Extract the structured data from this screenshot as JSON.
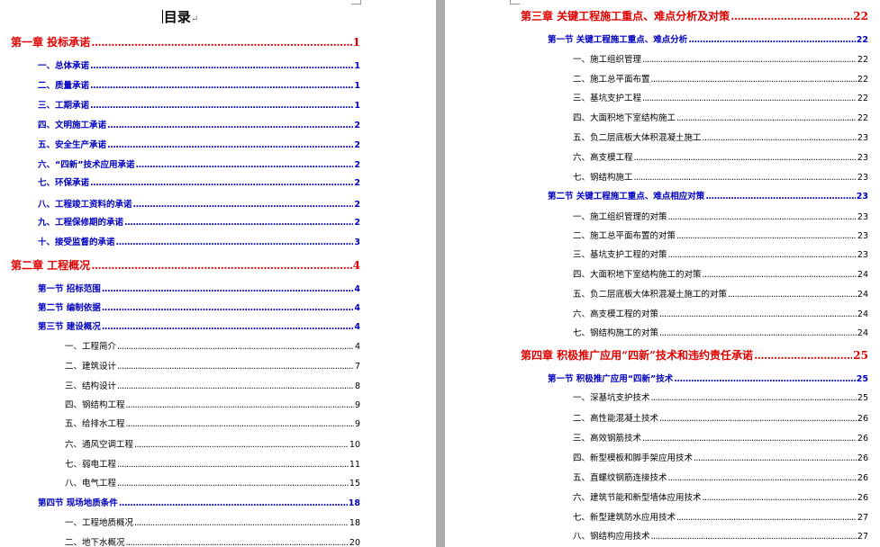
{
  "document": {
    "title": "目录",
    "paragraph_mark": "↵",
    "left_page": [
      {
        "level": 1,
        "text": "第一章  投标承诺",
        "page": "1"
      },
      {
        "level": 2,
        "text": "一、总体承诺",
        "page": "1"
      },
      {
        "level": 2,
        "text": "二、质量承诺",
        "page": "1"
      },
      {
        "level": 2,
        "text": "三、工期承诺",
        "page": "1"
      },
      {
        "level": 2,
        "text": "四、文明施工承诺",
        "page": "2"
      },
      {
        "level": 2,
        "text": "五、安全生产承诺",
        "page": "2"
      },
      {
        "level": 2,
        "text": "六、“四新”技术应用承诺",
        "page": "2"
      },
      {
        "level": 2,
        "text": "七、环保承诺",
        "page": "2"
      },
      {
        "level": 2,
        "text": "八、工程竣工资料的承诺",
        "page": "2"
      },
      {
        "level": 2,
        "text": "九、工程保修期的承诺",
        "page": "2"
      },
      {
        "level": 2,
        "text": "十、接受监督的承诺",
        "page": "3"
      },
      {
        "level": 1,
        "text": "第二章  工程概况",
        "page": "4"
      },
      {
        "level": 2,
        "text": "第一节  招标范围",
        "page": "4"
      },
      {
        "level": 2,
        "text": "第二节  编制依据",
        "page": "4"
      },
      {
        "level": 2,
        "text": "第三节  建设概况",
        "page": "4"
      },
      {
        "level": 3,
        "text": "一、工程简介",
        "page": "4"
      },
      {
        "level": 3,
        "text": "二、建筑设计",
        "page": "7"
      },
      {
        "level": 3,
        "text": "三、结构设计",
        "page": "8"
      },
      {
        "level": 3,
        "text": "四、钢结构工程",
        "page": "9"
      },
      {
        "level": 3,
        "text": "五、给排水工程",
        "page": "9"
      },
      {
        "level": 3,
        "text": "六、通风空调工程",
        "page": "10"
      },
      {
        "level": 3,
        "text": "七、弱电工程",
        "page": "11"
      },
      {
        "level": 3,
        "text": "八、电气工程",
        "page": "15"
      },
      {
        "level": 2,
        "text": "第四节  现场地质条件",
        "page": "18"
      },
      {
        "level": 3,
        "text": "一、工程地质概况",
        "page": "18"
      },
      {
        "level": 3,
        "text": "二、地下水概况",
        "page": "20"
      }
    ],
    "right_page": [
      {
        "level": 1,
        "text": "第三章  关键工程施工重点、难点分析及对策",
        "page": "22"
      },
      {
        "level": 2,
        "text": "第一节  关键工程施工重点、难点分析",
        "page": "22"
      },
      {
        "level": 3,
        "text": "一、施工组织管理",
        "page": "22"
      },
      {
        "level": 3,
        "text": "二、施工总平面布置",
        "page": "22"
      },
      {
        "level": 3,
        "text": "三、基坑支护工程",
        "page": "22"
      },
      {
        "level": 3,
        "text": "四、大面积地下室结构施工",
        "page": "22"
      },
      {
        "level": 3,
        "text": "五、负二层底板大体积混凝土施工",
        "page": "23"
      },
      {
        "level": 3,
        "text": "六、高支模工程",
        "page": "23"
      },
      {
        "level": 3,
        "text": "七、钢结构施工",
        "page": "23"
      },
      {
        "level": 2,
        "text": "第二节  关键工程施工重点、难点相应对策",
        "page": "23"
      },
      {
        "level": 3,
        "text": "一、施工组织管理的对策",
        "page": "23"
      },
      {
        "level": 3,
        "text": "二、施工总平面布置的对策",
        "page": "23"
      },
      {
        "level": 3,
        "text": "三、基坑支护工程的对策",
        "page": "23"
      },
      {
        "level": 3,
        "text": "四、大面积地下室结构施工的对策",
        "page": "24"
      },
      {
        "level": 3,
        "text": "五、负二层底板大体积混凝土施工的对策",
        "page": "24"
      },
      {
        "level": 3,
        "text": "六、高支模工程的对策",
        "page": "24"
      },
      {
        "level": 3,
        "text": "七、钢结构施工的对策",
        "page": "24"
      },
      {
        "level": 1,
        "text": "第四章  积极推广应用“四新”技术和违约责任承诺",
        "page": "25"
      },
      {
        "level": 2,
        "text": "第一节  积极推广应用“四新”技术",
        "page": "25"
      },
      {
        "level": 3,
        "text": "一、深基坑支护技术",
        "page": "25"
      },
      {
        "level": 3,
        "text": "二、高性能混凝土技术",
        "page": "26"
      },
      {
        "level": 3,
        "text": "三、高效钢筋技术",
        "page": "26"
      },
      {
        "level": 3,
        "text": "四、新型模板和脚手架应用技术",
        "page": "26"
      },
      {
        "level": 3,
        "text": "五、直螺纹钢筋连接技术",
        "page": "26"
      },
      {
        "level": 3,
        "text": "六、建筑节能和新型墙体应用技术",
        "page": "26"
      },
      {
        "level": 3,
        "text": "七、新型建筑防水应用技术",
        "page": "27"
      },
      {
        "level": 3,
        "text": "八、钢结构应用技术",
        "page": "27"
      }
    ]
  }
}
